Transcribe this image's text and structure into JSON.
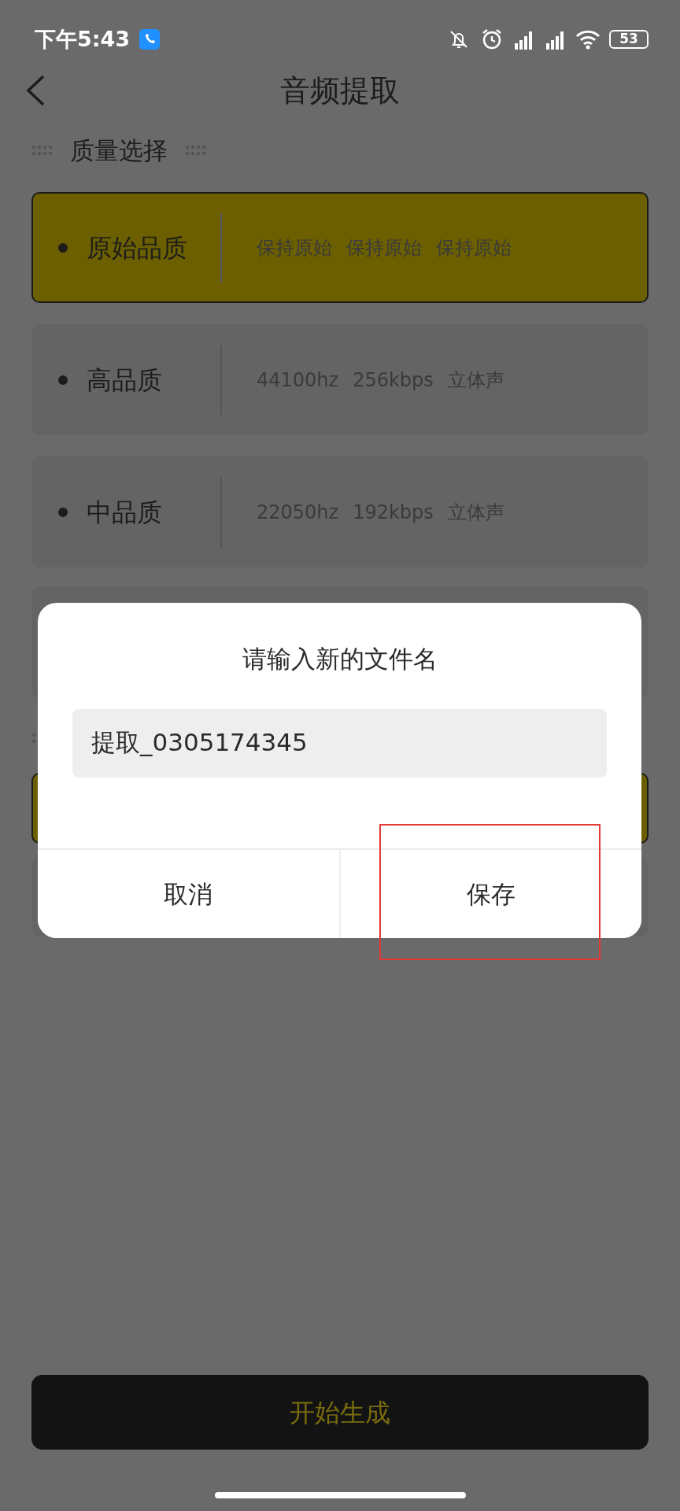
{
  "status_bar": {
    "time": "下午5:43",
    "battery": "53"
  },
  "header": {
    "title": "音频提取"
  },
  "section": {
    "title": "质量选择"
  },
  "qualities": [
    {
      "label": "原始品质",
      "details": [
        "保持原始",
        "保持原始",
        "保持原始"
      ],
      "selected": true
    },
    {
      "label": "高品质",
      "details": [
        "44100hz",
        "256kbps",
        "立体声"
      ],
      "selected": false
    },
    {
      "label": "中品质",
      "details": [
        "22050hz",
        "192kbps",
        "立体声"
      ],
      "selected": false
    }
  ],
  "dialog": {
    "title": "请输入新的文件名",
    "value": "提取_0305174345",
    "buttons": [
      "取消",
      "保存"
    ]
  },
  "primary_button": {
    "label": "开始生成"
  }
}
